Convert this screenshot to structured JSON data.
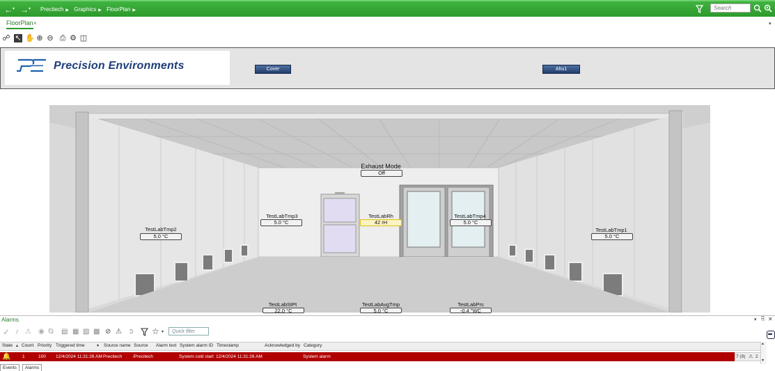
{
  "nav": {
    "back_icon": "back-arrow-icon",
    "forward_icon": "forward-arrow-icon",
    "breadcrumb": [
      "Precitech",
      "Graphics",
      "FloorPlan"
    ],
    "search_placeholder": "Search"
  },
  "tabs": [
    {
      "label": "FloorPlan",
      "close": "×"
    }
  ],
  "banner": {
    "logo_text": "Precision Environments",
    "cover_button": "Cover",
    "ahu_button": "Ahu1"
  },
  "floorplan": {
    "exhaust": {
      "label": "Exhaust Mode",
      "value": "Off"
    },
    "sensors": [
      {
        "label": "TestLabTmp2",
        "value": "5.0 °C"
      },
      {
        "label": "TestLabTmp3",
        "value": "5.0 °C"
      },
      {
        "label": "TestLabRh",
        "value": "42 rH"
      },
      {
        "label": "TestLabTmp4",
        "value": "5.0 °C"
      },
      {
        "label": "TestLabTmp1",
        "value": "5.0 °C"
      },
      {
        "label": "TestLabStPt",
        "value": "22.0 °C"
      },
      {
        "label": "TestLabAvgTmp",
        "value": "5.0 °C"
      },
      {
        "label": "TestLabPrs",
        "value": "-0.4 \"WC"
      }
    ]
  },
  "alarms": {
    "title": "Alarms",
    "quick_filter_placeholder": "Quick filter",
    "columns": [
      "State",
      "Count",
      "Priority",
      "Triggered time",
      "Source name",
      "Source",
      "Alarm text",
      "System alarm ID",
      "Timestamp",
      "Acknowledged by",
      "Category"
    ],
    "row": {
      "count": "1",
      "priority": "100",
      "triggered": "12/4/2024 11:31:26 AM",
      "source_name": "Precitech",
      "source": "/Precitech",
      "alarm_text": "System cold start",
      "timestamp": "12/4/2024 11:31:26 AM",
      "category": "System alarm"
    },
    "counter": "7 (9)",
    "counter2": "2"
  },
  "bottom_tabs": [
    "Events",
    "Alarms"
  ],
  "colors": {
    "accent": "#2c9a2c",
    "alarm_row": "#b00000",
    "button": "#2f4d80"
  }
}
